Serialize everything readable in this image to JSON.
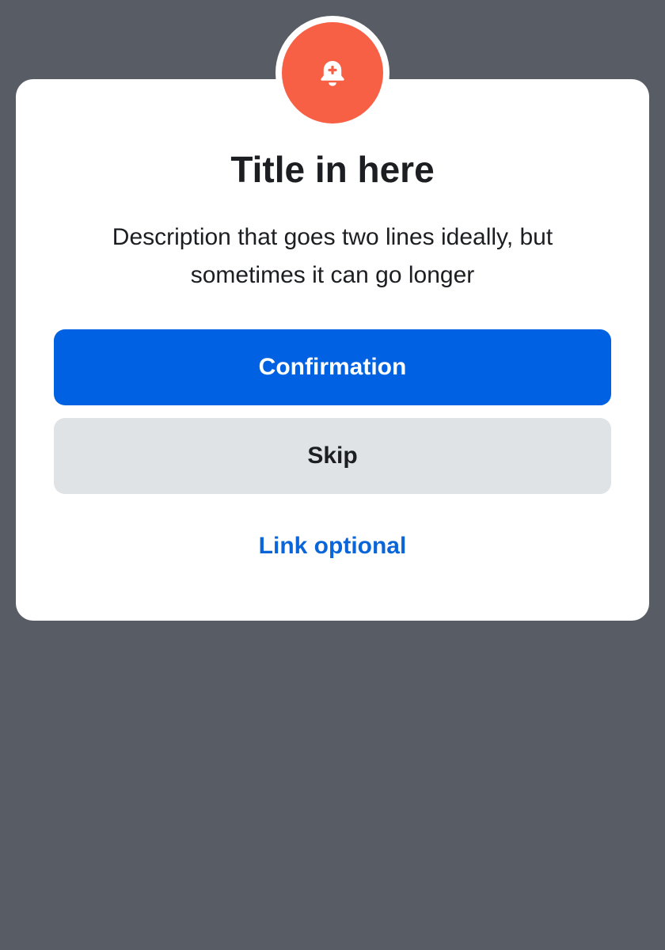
{
  "dialog": {
    "icon": "bell-plus-icon",
    "title": "Title in here",
    "description": "Description that goes two lines ideally, but sometimes it can go longer",
    "primary_button_label": "Confirmation",
    "secondary_button_label": "Skip",
    "link_label": "Link optional"
  },
  "colors": {
    "scrim": "#585c64",
    "badge": "#f76045",
    "primary": "#0062e3",
    "secondary": "#e0e3e6",
    "link": "#0a66d8",
    "text": "#1c1e21"
  }
}
